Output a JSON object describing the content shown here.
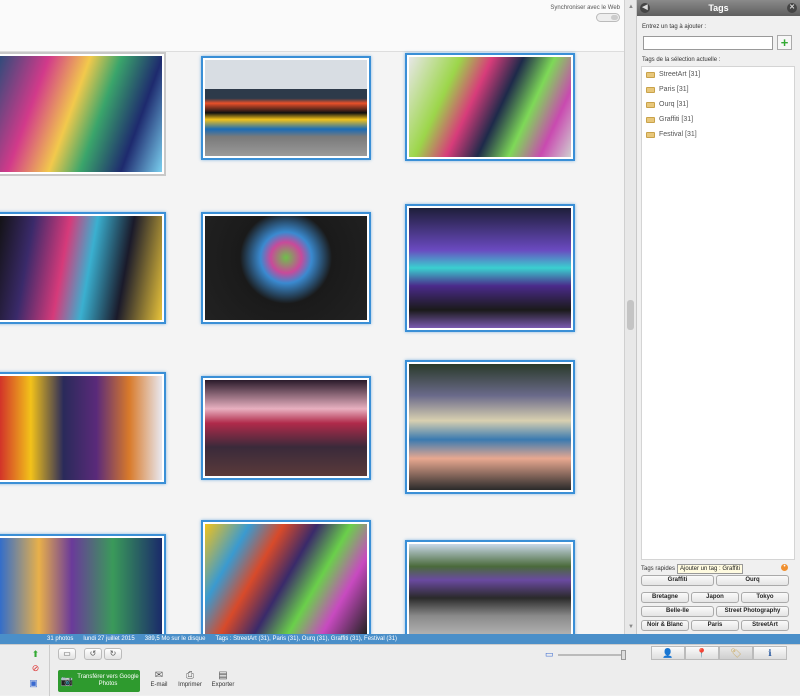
{
  "header": {
    "sync_label": "Synchroniser avec le Web"
  },
  "panel": {
    "title": "Tags",
    "input_label": "Entrez un tag à ajouter :",
    "input_value": "",
    "add_icon": "plus-icon",
    "list_label": "Tags de la sélection actuelle :",
    "tags": [
      {
        "label": "StreetArt [31]"
      },
      {
        "label": "Paris [31]"
      },
      {
        "label": "Ourq [31]"
      },
      {
        "label": "Graffiti [31]"
      },
      {
        "label": "Festival [31]"
      }
    ],
    "quick_label": "Tags rapides",
    "tooltip": "Ajouter un tag : Graffiti",
    "quick_rows": [
      [
        "Graffiti",
        "Ourq"
      ],
      [
        "Bretagne",
        "Japon",
        "Tokyo"
      ],
      [
        "Belle-Ile",
        "Street Photography"
      ],
      [
        "Noir & Blanc",
        "Paris",
        "StreetArt"
      ]
    ]
  },
  "status": {
    "count": "31 photos",
    "date": "lundi 27 juillet 2015",
    "size": "389,5 Mo sur le disque",
    "tags": "Tags : StreetArt (31), Paris (31), Ourq (31), Graffiti (31), Festival (31)"
  },
  "toolbar": {
    "upload": "Transférer vers Google Photos",
    "email": "E-mail",
    "print": "Imprimer",
    "export": "Exporter",
    "zoom_level": 1.0
  },
  "colors": {
    "accent": "#3a8fd6",
    "status_bar": "#4a8fc9",
    "upload": "#2e9a2e"
  }
}
